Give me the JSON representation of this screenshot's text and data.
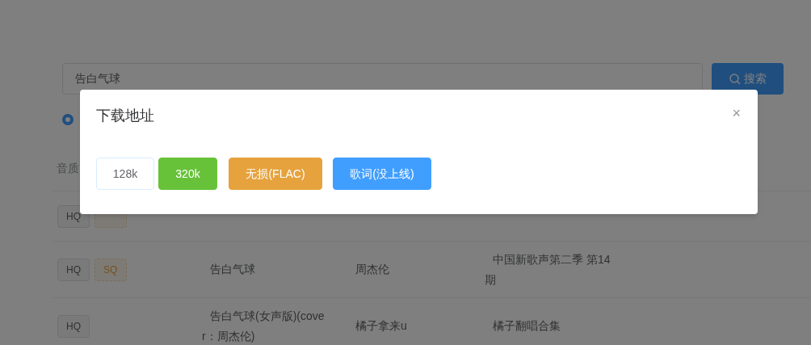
{
  "search": {
    "value": "告白气球",
    "button": "搜索"
  },
  "radio": {
    "selected": true
  },
  "table": {
    "columns": [
      "音质"
    ],
    "rows": [
      {
        "quality": [
          {
            "label": "HQ",
            "kind": "hq"
          },
          {
            "kind": "sq"
          }
        ]
      },
      {
        "quality": [
          {
            "label": "HQ",
            "kind": "hq"
          },
          {
            "label": "SQ",
            "kind": "sq"
          }
        ],
        "title": "告白气球",
        "artist": "周杰伦",
        "album": "中国新歌声第二季 第14期"
      },
      {
        "quality": [
          {
            "label": "HQ",
            "kind": "hq"
          }
        ],
        "title": "告白气球(女声版)(cover：周杰伦)",
        "artist": "橘子拿来u",
        "album": "橘子翻唱合集"
      }
    ]
  },
  "dialog": {
    "title": "下载地址",
    "close": "×",
    "buttons": [
      {
        "label": "128k",
        "kind": "plain"
      },
      {
        "label": "320k",
        "kind": "success"
      },
      {
        "label": "无损(FLAC)",
        "kind": "warning"
      },
      {
        "label": "歌词(没上线)",
        "kind": "primary"
      }
    ]
  }
}
